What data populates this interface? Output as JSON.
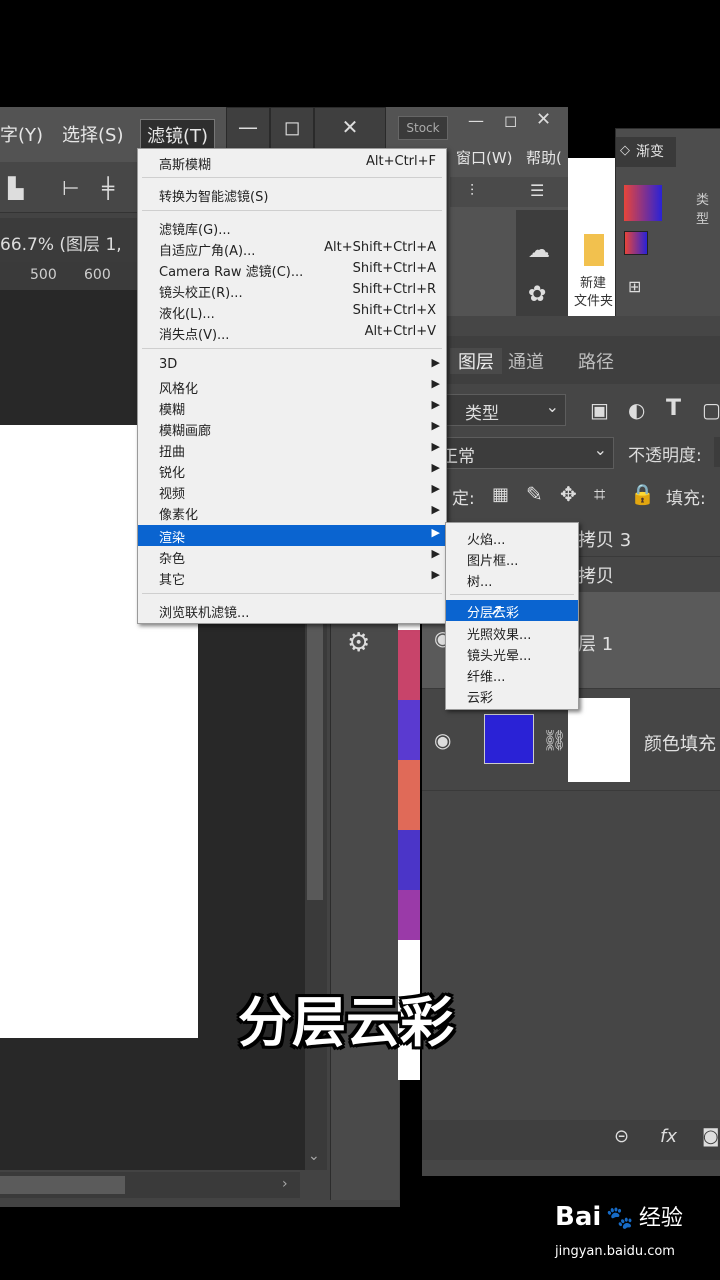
{
  "ps_menu": {
    "text_menu": "字(Y)",
    "select_menu": "选择(S)",
    "filter_menu": "滤镜(T)"
  },
  "doc": {
    "tab_label": "66.7% (图层 1,",
    "ruler_marks": [
      "500",
      "600"
    ]
  },
  "win2": {
    "stock_label": "Stock",
    "window_menu": "窗口(W)",
    "help_menu": "帮助("
  },
  "folder": {
    "label_line1": "新建",
    "label_line2": "文件夹"
  },
  "gradient_panel": {
    "title": "渐变",
    "type_label": "类型"
  },
  "layers_panel": {
    "tabs": [
      "图层",
      "通道",
      "路径"
    ],
    "filter_kind": "类型",
    "blend_mode": "正常",
    "opacity_label": "不透明度:",
    "lock_label": "定:",
    "fill_label": "填充:",
    "layers": [
      {
        "name": "拷贝 3"
      },
      {
        "name": "拷贝"
      },
      {
        "name": "层 1"
      },
      {
        "name": "颜色填充"
      }
    ],
    "fx_label": "fx"
  },
  "filter_dropdown": {
    "items": [
      {
        "label": "高斯模糊",
        "shortcut": "Alt+Ctrl+F"
      },
      {
        "label": "转换为智能滤镜(S)",
        "shortcut": ""
      },
      {
        "label": "滤镜库(G)...",
        "shortcut": ""
      },
      {
        "label": "自适应广角(A)...",
        "shortcut": "Alt+Shift+Ctrl+A"
      },
      {
        "label": "Camera Raw 滤镜(C)...",
        "shortcut": "Shift+Ctrl+A"
      },
      {
        "label": "镜头校正(R)...",
        "shortcut": "Shift+Ctrl+R"
      },
      {
        "label": "液化(L)...",
        "shortcut": "Shift+Ctrl+X"
      },
      {
        "label": "消失点(V)...",
        "shortcut": "Alt+Ctrl+V"
      },
      {
        "label": "3D"
      },
      {
        "label": "风格化"
      },
      {
        "label": "模糊"
      },
      {
        "label": "模糊画廊"
      },
      {
        "label": "扭曲"
      },
      {
        "label": "锐化"
      },
      {
        "label": "视频"
      },
      {
        "label": "像素化"
      },
      {
        "label": "渲染"
      },
      {
        "label": "杂色"
      },
      {
        "label": "其它"
      },
      {
        "label": "浏览联机滤镜..."
      }
    ]
  },
  "render_submenu": {
    "items": [
      "火焰...",
      "图片框...",
      "树...",
      "分层云彩",
      "光照效果...",
      "镜头光晕...",
      "纤维...",
      "云彩"
    ]
  },
  "caption": "分层云彩",
  "watermark": {
    "brand": "Bai",
    "brand2": "经验",
    "url": "jingyan.baidu.com"
  },
  "colors": {
    "menu_highlight": "#0a64d0",
    "layer_fill": "#2a22d6"
  }
}
